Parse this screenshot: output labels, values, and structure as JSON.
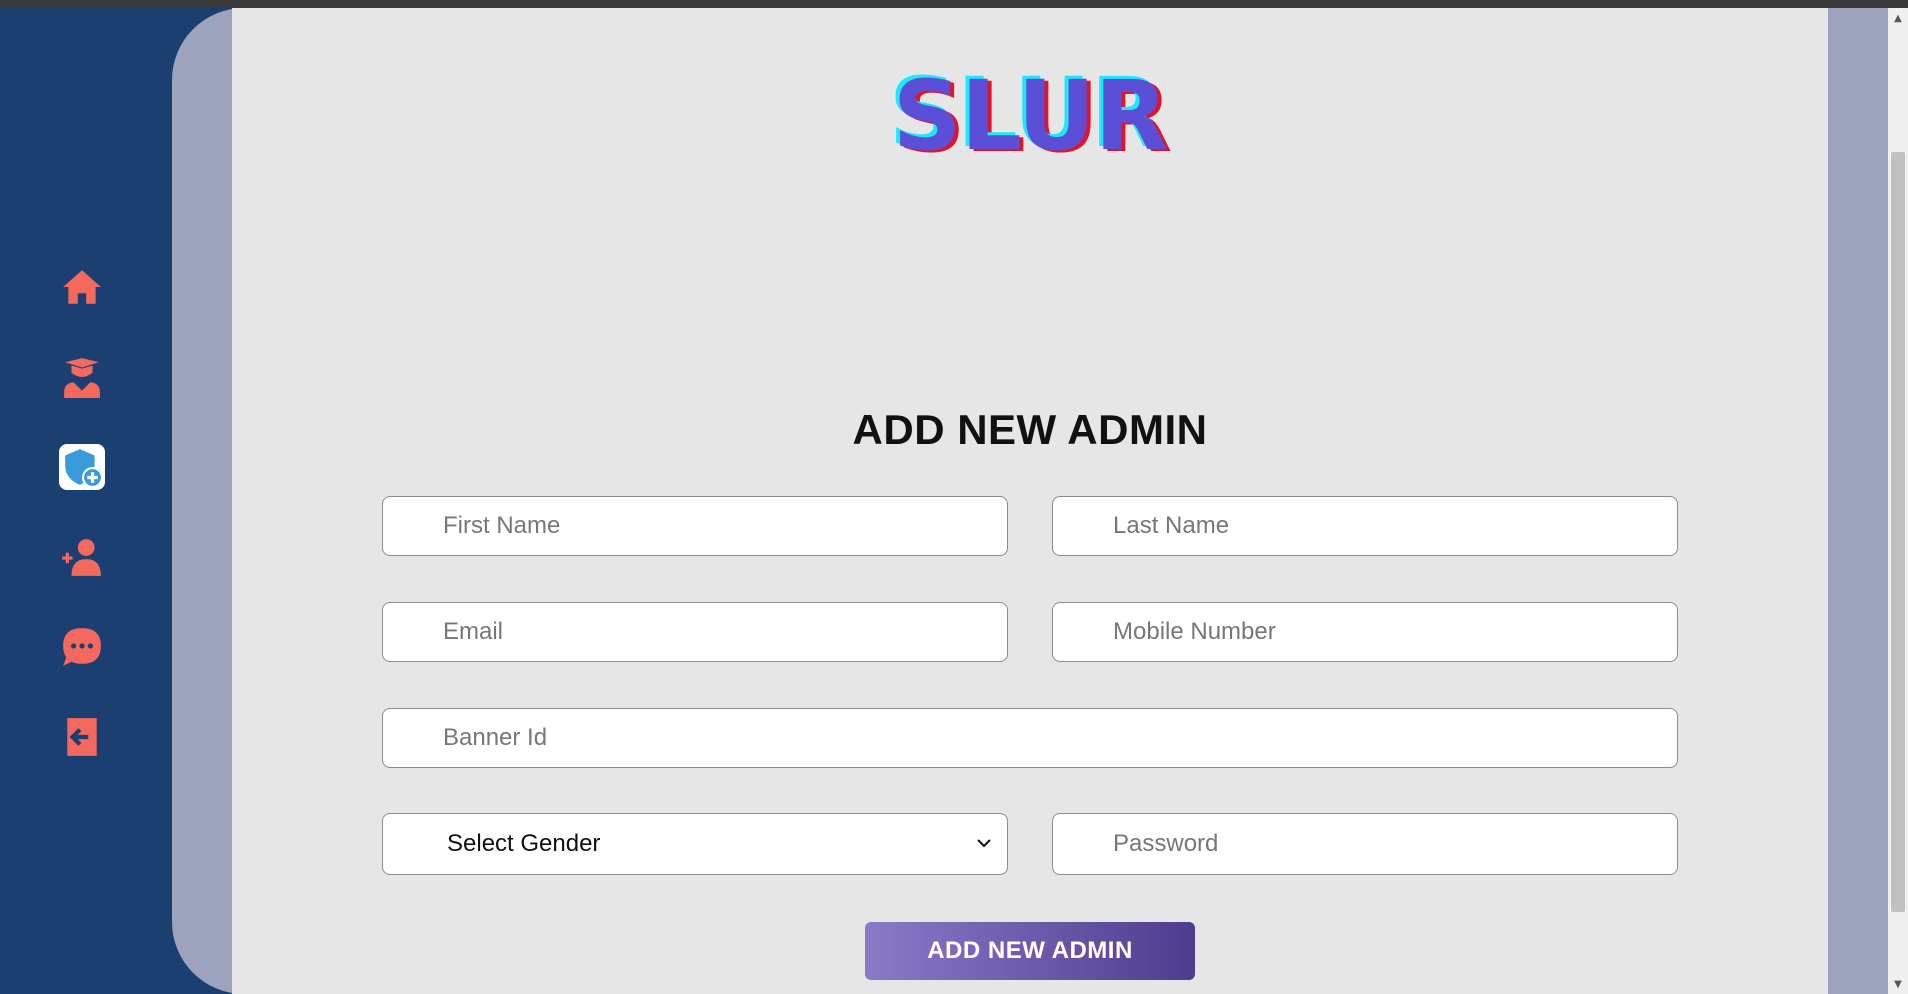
{
  "brand": {
    "logo_text": "SLUR"
  },
  "sidebar": {
    "items": [
      {
        "name": "home",
        "icon": "home-icon"
      },
      {
        "name": "students",
        "icon": "graduate-icon"
      },
      {
        "name": "add-admin",
        "icon": "shield-plus-icon",
        "active": true
      },
      {
        "name": "add-user",
        "icon": "user-plus-icon"
      },
      {
        "name": "messages",
        "icon": "chat-bubble-icon"
      },
      {
        "name": "logout",
        "icon": "sign-out-icon"
      }
    ]
  },
  "form": {
    "title": "ADD NEW ADMIN",
    "first_name_placeholder": "First Name",
    "last_name_placeholder": "Last Name",
    "email_placeholder": "Email",
    "mobile_placeholder": "Mobile Number",
    "banner_placeholder": "Banner Id",
    "gender_selected": "Select Gender",
    "password_placeholder": "Password",
    "submit_label": "ADD NEW ADMIN"
  },
  "colors": {
    "sidebar_bg": "#1c3f72",
    "icon_accent": "#f4695d",
    "content_bg": "#e6e6e6",
    "frame_bg": "#9ea3bd",
    "button_gradient_start": "#8a7ac8",
    "button_gradient_end": "#4f3c8f"
  }
}
